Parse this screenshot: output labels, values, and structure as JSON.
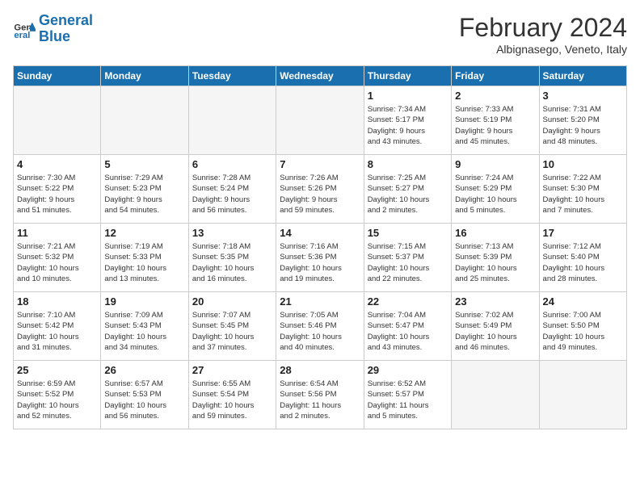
{
  "logo": {
    "line1": "General",
    "line2": "Blue"
  },
  "title": "February 2024",
  "location": "Albignasego, Veneto, Italy",
  "days_of_week": [
    "Sunday",
    "Monday",
    "Tuesday",
    "Wednesday",
    "Thursday",
    "Friday",
    "Saturday"
  ],
  "weeks": [
    [
      {
        "day": "",
        "info": ""
      },
      {
        "day": "",
        "info": ""
      },
      {
        "day": "",
        "info": ""
      },
      {
        "day": "",
        "info": ""
      },
      {
        "day": "1",
        "info": "Sunrise: 7:34 AM\nSunset: 5:17 PM\nDaylight: 9 hours\nand 43 minutes."
      },
      {
        "day": "2",
        "info": "Sunrise: 7:33 AM\nSunset: 5:19 PM\nDaylight: 9 hours\nand 45 minutes."
      },
      {
        "day": "3",
        "info": "Sunrise: 7:31 AM\nSunset: 5:20 PM\nDaylight: 9 hours\nand 48 minutes."
      }
    ],
    [
      {
        "day": "4",
        "info": "Sunrise: 7:30 AM\nSunset: 5:22 PM\nDaylight: 9 hours\nand 51 minutes."
      },
      {
        "day": "5",
        "info": "Sunrise: 7:29 AM\nSunset: 5:23 PM\nDaylight: 9 hours\nand 54 minutes."
      },
      {
        "day": "6",
        "info": "Sunrise: 7:28 AM\nSunset: 5:24 PM\nDaylight: 9 hours\nand 56 minutes."
      },
      {
        "day": "7",
        "info": "Sunrise: 7:26 AM\nSunset: 5:26 PM\nDaylight: 9 hours\nand 59 minutes."
      },
      {
        "day": "8",
        "info": "Sunrise: 7:25 AM\nSunset: 5:27 PM\nDaylight: 10 hours\nand 2 minutes."
      },
      {
        "day": "9",
        "info": "Sunrise: 7:24 AM\nSunset: 5:29 PM\nDaylight: 10 hours\nand 5 minutes."
      },
      {
        "day": "10",
        "info": "Sunrise: 7:22 AM\nSunset: 5:30 PM\nDaylight: 10 hours\nand 7 minutes."
      }
    ],
    [
      {
        "day": "11",
        "info": "Sunrise: 7:21 AM\nSunset: 5:32 PM\nDaylight: 10 hours\nand 10 minutes."
      },
      {
        "day": "12",
        "info": "Sunrise: 7:19 AM\nSunset: 5:33 PM\nDaylight: 10 hours\nand 13 minutes."
      },
      {
        "day": "13",
        "info": "Sunrise: 7:18 AM\nSunset: 5:35 PM\nDaylight: 10 hours\nand 16 minutes."
      },
      {
        "day": "14",
        "info": "Sunrise: 7:16 AM\nSunset: 5:36 PM\nDaylight: 10 hours\nand 19 minutes."
      },
      {
        "day": "15",
        "info": "Sunrise: 7:15 AM\nSunset: 5:37 PM\nDaylight: 10 hours\nand 22 minutes."
      },
      {
        "day": "16",
        "info": "Sunrise: 7:13 AM\nSunset: 5:39 PM\nDaylight: 10 hours\nand 25 minutes."
      },
      {
        "day": "17",
        "info": "Sunrise: 7:12 AM\nSunset: 5:40 PM\nDaylight: 10 hours\nand 28 minutes."
      }
    ],
    [
      {
        "day": "18",
        "info": "Sunrise: 7:10 AM\nSunset: 5:42 PM\nDaylight: 10 hours\nand 31 minutes."
      },
      {
        "day": "19",
        "info": "Sunrise: 7:09 AM\nSunset: 5:43 PM\nDaylight: 10 hours\nand 34 minutes."
      },
      {
        "day": "20",
        "info": "Sunrise: 7:07 AM\nSunset: 5:45 PM\nDaylight: 10 hours\nand 37 minutes."
      },
      {
        "day": "21",
        "info": "Sunrise: 7:05 AM\nSunset: 5:46 PM\nDaylight: 10 hours\nand 40 minutes."
      },
      {
        "day": "22",
        "info": "Sunrise: 7:04 AM\nSunset: 5:47 PM\nDaylight: 10 hours\nand 43 minutes."
      },
      {
        "day": "23",
        "info": "Sunrise: 7:02 AM\nSunset: 5:49 PM\nDaylight: 10 hours\nand 46 minutes."
      },
      {
        "day": "24",
        "info": "Sunrise: 7:00 AM\nSunset: 5:50 PM\nDaylight: 10 hours\nand 49 minutes."
      }
    ],
    [
      {
        "day": "25",
        "info": "Sunrise: 6:59 AM\nSunset: 5:52 PM\nDaylight: 10 hours\nand 52 minutes."
      },
      {
        "day": "26",
        "info": "Sunrise: 6:57 AM\nSunset: 5:53 PM\nDaylight: 10 hours\nand 56 minutes."
      },
      {
        "day": "27",
        "info": "Sunrise: 6:55 AM\nSunset: 5:54 PM\nDaylight: 10 hours\nand 59 minutes."
      },
      {
        "day": "28",
        "info": "Sunrise: 6:54 AM\nSunset: 5:56 PM\nDaylight: 11 hours\nand 2 minutes."
      },
      {
        "day": "29",
        "info": "Sunrise: 6:52 AM\nSunset: 5:57 PM\nDaylight: 11 hours\nand 5 minutes."
      },
      {
        "day": "",
        "info": ""
      },
      {
        "day": "",
        "info": ""
      }
    ]
  ]
}
